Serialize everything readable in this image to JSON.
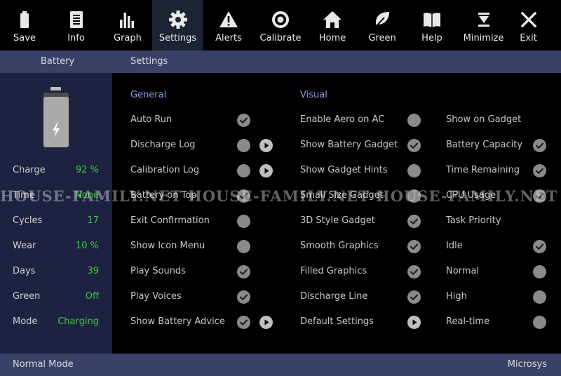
{
  "toolbar": {
    "buttons": [
      {
        "label": "Save",
        "icon": "battery-icon"
      },
      {
        "label": "Info",
        "icon": "document-icon"
      },
      {
        "label": "Graph",
        "icon": "bar-graph-icon"
      },
      {
        "label": "Settings",
        "icon": "gear-icon",
        "active": true
      },
      {
        "label": "Alerts",
        "icon": "warning-icon"
      },
      {
        "label": "Calibrate",
        "icon": "target-icon"
      },
      {
        "label": "Home",
        "icon": "home-icon"
      },
      {
        "label": "Green",
        "icon": "leaf-icon"
      },
      {
        "label": "Help",
        "icon": "book-icon"
      },
      {
        "label": "Minimize",
        "icon": "minimize-icon"
      },
      {
        "label": "Exit",
        "icon": "close-icon"
      }
    ]
  },
  "subheader": {
    "left": "Battery",
    "right": "Settings"
  },
  "sidebar": {
    "stats": [
      {
        "label": "Charge",
        "value": "92 %"
      },
      {
        "label": "Time",
        "value": "None"
      },
      {
        "label": "Cycles",
        "value": "17"
      },
      {
        "label": "Wear",
        "value": "10 %"
      },
      {
        "label": "Days",
        "value": "39"
      },
      {
        "label": "Green",
        "value": "Off"
      },
      {
        "label": "Mode",
        "value": "Charging"
      }
    ]
  },
  "general": {
    "title": "General",
    "options": [
      {
        "label": "Auto Run",
        "checked": true
      },
      {
        "label": "Discharge Log",
        "checked": false,
        "play": true
      },
      {
        "label": "Calibration Log",
        "checked": false,
        "play": true
      },
      {
        "label": "Battery on Top",
        "checked": true
      },
      {
        "label": "Exit Confirmation",
        "checked": false
      },
      {
        "label": "Show Icon Menu",
        "checked": false
      },
      {
        "label": "Play Sounds",
        "checked": true
      },
      {
        "label": "Play Voices",
        "checked": true
      },
      {
        "label": "Show Battery Advice",
        "checked": true,
        "play": true
      }
    ]
  },
  "visual": {
    "title": "Visual",
    "options": [
      {
        "label": "Enable Aero on AC",
        "checked": false
      },
      {
        "label": "Show Battery Gadget",
        "checked": true
      },
      {
        "label": "Show Gadget Hints",
        "checked": false
      },
      {
        "label": "Small Size Gadget",
        "checked": false
      },
      {
        "label": "3D Style Gadget",
        "checked": true
      },
      {
        "label": "Smooth Graphics",
        "checked": true
      },
      {
        "label": "Filled Graphics",
        "checked": true
      },
      {
        "label": "Discharge Line",
        "checked": true
      },
      {
        "label": "Default Settings",
        "checked": null,
        "play": true
      }
    ]
  },
  "gadget": {
    "options": [
      {
        "label": "Show on Gadget",
        "checked": null
      },
      {
        "label": "Battery Capacity",
        "checked": true
      },
      {
        "label": "Time Remaining",
        "checked": true
      },
      {
        "label": "CPU Usage",
        "checked": true
      },
      {
        "label": "Task Priority",
        "checked": null
      },
      {
        "label": "Idle",
        "checked": true
      },
      {
        "label": "Normal",
        "checked": false
      },
      {
        "label": "High",
        "checked": false
      },
      {
        "label": "Real-time",
        "checked": false
      }
    ]
  },
  "statusbar": {
    "left": "Normal Mode",
    "right": "Microsys"
  },
  "watermark": "HOUSE-FAMILY.NET HOUSE-FAMILY.NET HOUSE-FAMILY.NET HOUSE-FAMILY.NET",
  "colors": {
    "background": "#000000",
    "bar": "#3a4166",
    "sidebar": "#1d2240",
    "active_tab": "#1c2333",
    "accent_heading": "#8ba0e6",
    "value_green": "#43c443",
    "check_off": "#8a8a8a"
  }
}
